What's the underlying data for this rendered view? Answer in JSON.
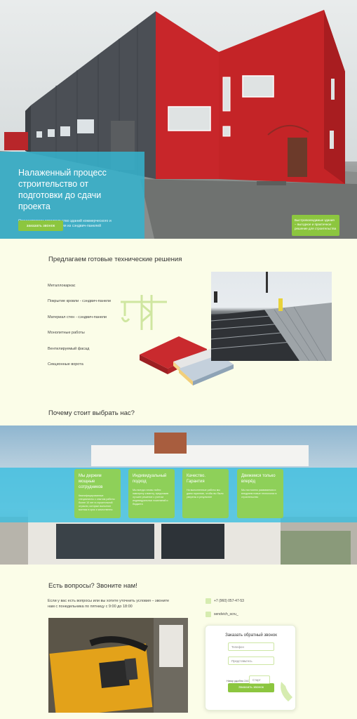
{
  "hero": {
    "title": "Налаженный процесс строительство от подготовки до сдачи проекта",
    "subtitle": "Осуществляем строительство зданий коммерческого и промышленного назначения из сэндвич-панелей",
    "cta_label": "заказать звонок",
    "badge_text": "Быстровозводимые здания – выгодное и практичное решение для строительства"
  },
  "solutions": {
    "title": "Предлагаем готовые технические решения",
    "items": [
      "Металлокаркас",
      "Покрытие кровли - сэндвич-панели",
      "Материал стен - сэндвич-панели",
      "Монолитные работы",
      "Вентилируемый фасад",
      "Секционные ворота"
    ]
  },
  "why": {
    "title": "Почему стоит выбрать нас?",
    "cards": [
      {
        "title": "Мы держим мощные сотрудников",
        "text": "Квалифицированные специалисты с опытом работы более 10 лет в строительной отрасли, которые выполнят монтаж в срок и качественно"
      },
      {
        "title": "Индивидуальный подход",
        "text": "Мы всегда готовы пойти навстречу клиенту, предложив лучшее решение с учетом индивидуальных пожеланий и бюджета"
      },
      {
        "title": "Качество. Гарантия",
        "text": "На выполненные работы мы даем гарантию, чтобы вы были уверены в результате"
      },
      {
        "title": "Движемся только вперёд",
        "text": "Мы постоянно развиваемся и внедряем новые технологии в строительство"
      }
    ]
  },
  "contacts": {
    "title": "Есть вопросы? Звоните нам!",
    "intro": "Если у вас есть вопросы или вы хотите уточнить условия – звоните нам с понедельника по пятницу с 9:00 до 18:00",
    "phone": "+7 (960) 057-47-53",
    "social": "sendvich_scru_"
  },
  "form": {
    "title": "Заказать обратный звонок",
    "phone_placeholder": "Телефон",
    "name_placeholder": "Представьтесь",
    "comment_placeholder": "Комментарий",
    "time_label": "Ниму удобно 24/7",
    "time_placeholder": "Старт",
    "submit_label": "Заказать звонок"
  },
  "colors": {
    "accent_green": "#8cc63f",
    "accent_blue": "#36b2cc",
    "background": "#fbfde8",
    "building_red": "#c8262a"
  }
}
